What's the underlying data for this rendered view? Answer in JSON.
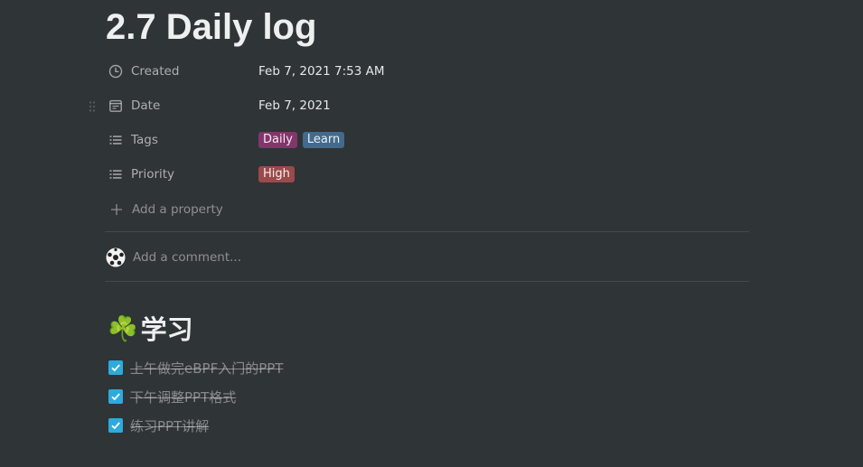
{
  "page": {
    "title": "2.7 Daily log"
  },
  "properties": [
    {
      "name": "Created",
      "icon": "clock-icon",
      "value": "Feb 7, 2021 7:53 AM"
    },
    {
      "name": "Date",
      "icon": "calendar-icon",
      "value": "Feb 7, 2021"
    },
    {
      "name": "Tags",
      "icon": "list-icon",
      "tags": [
        {
          "label": "Daily",
          "color": "#83366b"
        },
        {
          "label": "Learn",
          "color": "#426a8c"
        }
      ]
    },
    {
      "name": "Priority",
      "icon": "list-icon",
      "tags": [
        {
          "label": "High",
          "color": "#9a4a4a"
        }
      ]
    }
  ],
  "add_property_label": "Add a property",
  "comment": {
    "placeholder": "Add a comment..."
  },
  "section": {
    "emoji": "☘️",
    "heading": "学习"
  },
  "todos": [
    {
      "text": "上午做完eBPF入门的PPT",
      "checked": true
    },
    {
      "text": "下午调整PPT格式",
      "checked": true
    },
    {
      "text": "练习PPT讲解",
      "checked": true
    }
  ],
  "colors": {
    "background": "#2f3437",
    "checkbox": "#2eaadc"
  }
}
